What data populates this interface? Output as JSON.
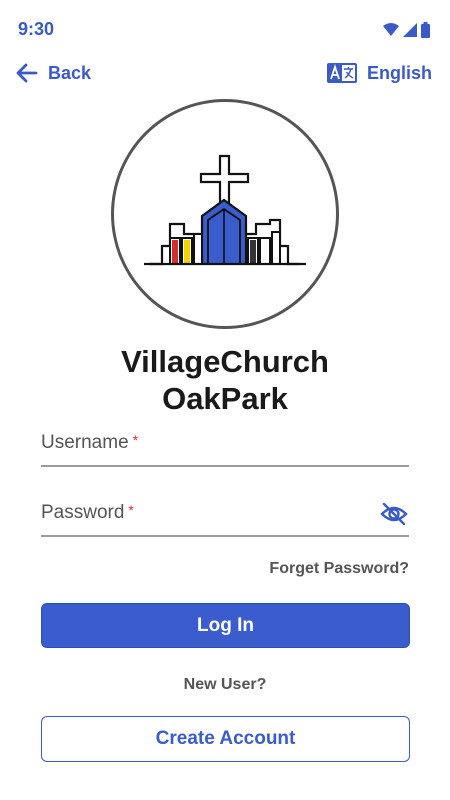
{
  "status": {
    "time": "9:30"
  },
  "nav": {
    "back_label": "Back",
    "language_label": "English"
  },
  "org": {
    "line1": "VillageChurch",
    "line2": "OakPark"
  },
  "form": {
    "username_placeholder": "Username",
    "password_placeholder": "Password",
    "required_mark": "*",
    "forget_password": "Forget Password?",
    "login_label": "Log In",
    "new_user_label": "New User?",
    "create_account_label": "Create Account"
  },
  "colors": {
    "accent": "#3b5ccc",
    "required": "#d32f2f"
  },
  "icons": {
    "back": "arrow-left-icon",
    "language": "translate-icon",
    "password_visibility": "eye-off-icon",
    "wifi": "wifi-icon",
    "signal": "signal-icon",
    "battery": "battery-icon"
  }
}
